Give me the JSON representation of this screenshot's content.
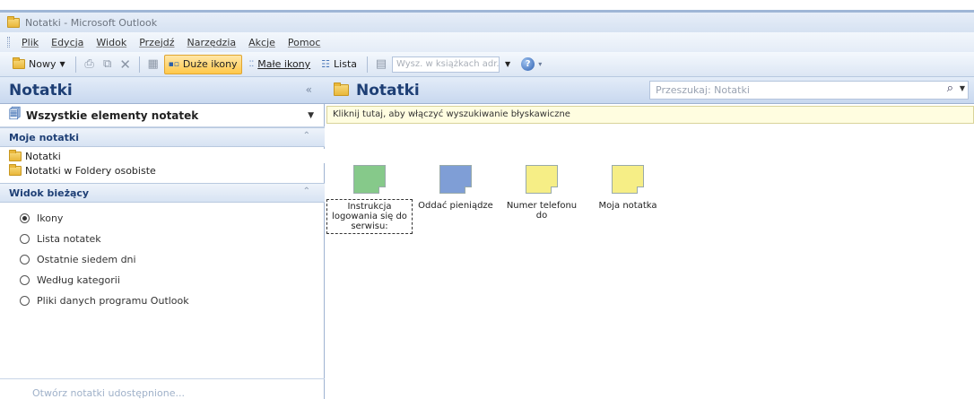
{
  "window": {
    "title": "Notatki - Microsoft Outlook"
  },
  "menu": [
    "Plik",
    "Edycja",
    "Widok",
    "Przejdź",
    "Narzędzia",
    "Akcje",
    "Pomoc"
  ],
  "toolbar": {
    "new_label": "Nowy",
    "large_icons_label": "Duże ikony",
    "small_icons_label": "Małe ikony",
    "list_label": "Lista",
    "address_search_placeholder": "Wysz. w książkach adr."
  },
  "nav": {
    "title": "Notatki",
    "all_items": "Wszystkie elementy notatek",
    "my_notes_header": "Moje notatki",
    "folders": [
      "Notatki",
      "Notatki w Foldery osobiste"
    ],
    "current_view_header": "Widok bieżący",
    "views": [
      {
        "label": "Ikony",
        "selected": true
      },
      {
        "label": "Lista notatek",
        "selected": false
      },
      {
        "label": "Ostatnie siedem dni",
        "selected": false
      },
      {
        "label": "Według kategorii",
        "selected": false
      },
      {
        "label": "Pliki danych programu Outlook",
        "selected": false
      }
    ],
    "footer_link": "Otwórz notatki udostępnione..."
  },
  "content": {
    "title": "Notatki",
    "search_placeholder": "Przeszukaj: Notatki",
    "info_bar": "Kliknij tutaj, aby włączyć wyszukiwanie błyskawiczne",
    "notes": [
      {
        "label": "Instrukcja logowania się do serwisu:",
        "color": "#86c98a",
        "focused": true
      },
      {
        "label": "Oddać pieniądze",
        "color": "#7f9ed6",
        "focused": false
      },
      {
        "label": "Numer telefonu do",
        "color": "#f6ee86",
        "focused": false
      },
      {
        "label": "Moja notatka",
        "color": "#f6ee86",
        "focused": false
      }
    ]
  },
  "colors": {
    "header_text": "#1e3f75",
    "active_button": "#ffc84a",
    "info_bar": "#fffde0"
  }
}
